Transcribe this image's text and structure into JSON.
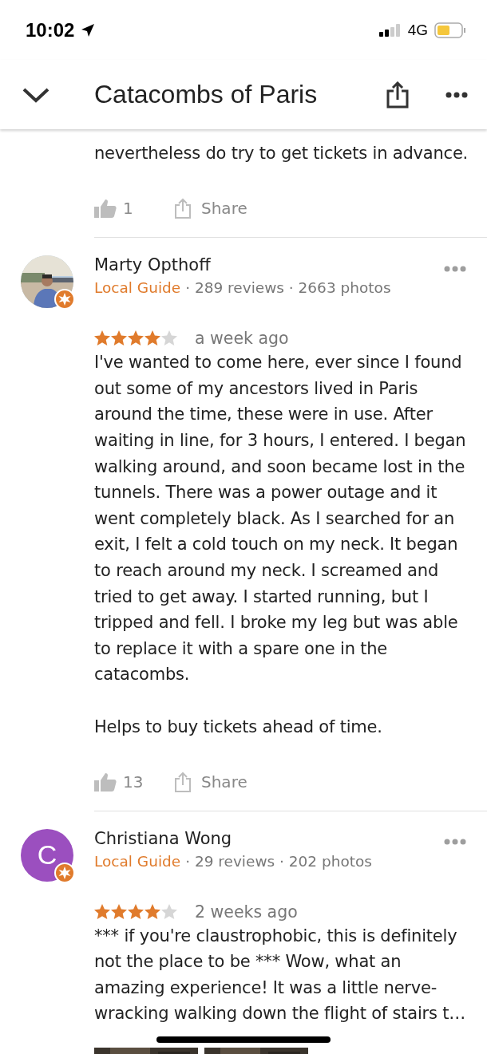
{
  "status_bar": {
    "time": "10:02",
    "network": "4G"
  },
  "header": {
    "title": "Catacombs of Paris"
  },
  "partial_review": {
    "paragraphs": [
      "nevertheless do try to get tickets in advance."
    ],
    "likes": "1",
    "share": "Share"
  },
  "reviews": [
    {
      "name": "Marty Opthoff",
      "avatar": {
        "kind": "picture"
      },
      "guide": "Local Guide",
      "stats": "· 289 reviews · 2663 photos",
      "stars": 4,
      "time": "a week ago",
      "paragraphs": [
        "I've wanted to come here, ever since I found out some of my ancestors lived in Paris around the time, these were in use. After waiting in line, for 3 hours, I entered. I began walking around, and soon became lost in the tunnels. There was a power outage and it went completely black. As I searched for an exit, I felt a cold touch on my neck. It began to reach around my neck. I screamed and tried to get away. I started running, but I tripped and fell. I broke my leg but was able to replace it with a spare one in the catacombs.",
        "Helps to buy tickets ahead of time."
      ],
      "likes": "13",
      "share": "Share"
    },
    {
      "name": "Christiana Wong",
      "avatar": {
        "kind": "letter",
        "letter": "C",
        "color": "#9b4fbf"
      },
      "guide": "Local Guide",
      "stats": "· 29 reviews · 202 photos",
      "stars": 4,
      "time": "2 weeks ago",
      "paragraphs": [
        "*** if you're claustrophobic, this is definitely not the place to be *** Wow, what an amazing experience! It was a little nerve-wracking walking down the flight of stairs t…"
      ],
      "photos": [
        {
          "kind": "picture"
        },
        {
          "kind": "picture"
        }
      ]
    }
  ]
}
